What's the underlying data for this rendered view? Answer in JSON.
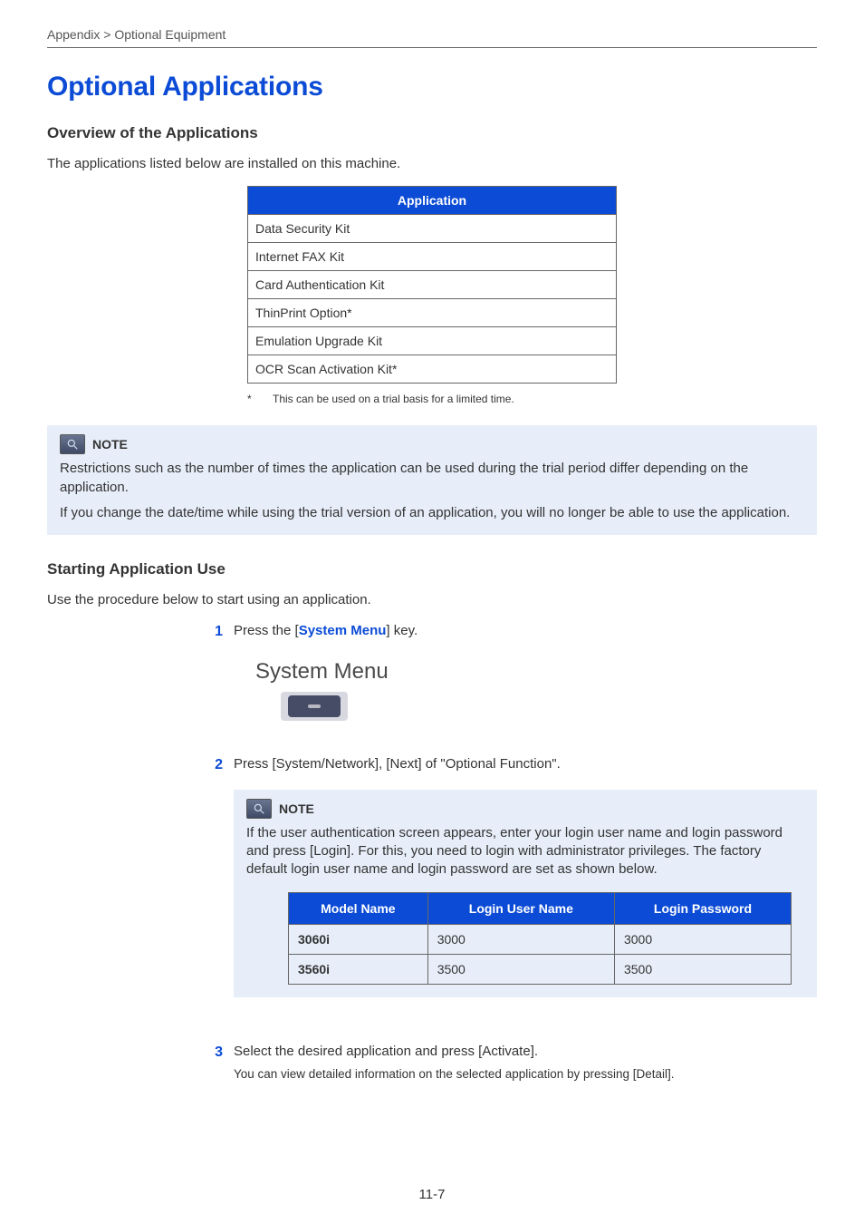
{
  "breadcrumb": "Appendix > Optional Equipment",
  "title": "Optional Applications",
  "section1": {
    "heading": "Overview of the Applications",
    "intro": "The applications listed below are installed on this machine."
  },
  "app_table": {
    "header": "Application",
    "rows": [
      "Data Security Kit",
      "Internet FAX Kit",
      "Card Authentication Kit",
      "ThinPrint Option*",
      "Emulation Upgrade Kit",
      "OCR Scan Activation Kit*"
    ]
  },
  "footnote": {
    "mark": "*",
    "text": "This can be used on a trial basis for a limited time."
  },
  "note1": {
    "label": "NOTE",
    "p1": "Restrictions such as the number of times the application can be used during the trial period differ depending on the application.",
    "p2": "If you change the date/time while using the trial version of an application, you will no longer be able to use the application."
  },
  "section2": {
    "heading": "Starting Application Use",
    "intro": "Use the procedure below to start using an application."
  },
  "steps": {
    "s1": {
      "num": "1",
      "pre": "Press the [",
      "link": "System Menu",
      "post": "] key."
    },
    "sysmenu_label": "System Menu",
    "s2": {
      "num": "2",
      "text": "Press [System/Network], [Next] of \"Optional Function\"."
    },
    "note2": {
      "label": "NOTE",
      "text": "If the user authentication screen appears, enter your login user name and login password and press [Login]. For this, you need to login with administrator privileges. The factory default login user name and login password are set as shown below."
    },
    "login_table": {
      "headers": [
        "Model Name",
        "Login User Name",
        "Login Password"
      ],
      "rows": [
        {
          "model": "3060i",
          "user": "3000",
          "pass": "3000"
        },
        {
          "model": "3560i",
          "user": "3500",
          "pass": "3500"
        }
      ]
    },
    "s3": {
      "num": "3",
      "text": "Select the desired application and press [Activate].",
      "sub": "You can view detailed information on the selected application by pressing [Detail]."
    }
  },
  "page_num": "11-7"
}
